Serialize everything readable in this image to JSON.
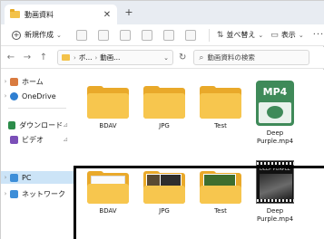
{
  "window": {
    "tab_title": "動画資料",
    "tab_close_icon": "close-icon",
    "new_tab_icon": "plus-icon"
  },
  "toolbar": {
    "new_label": "新規作成",
    "sort_label": "並べ替え",
    "view_label": "表示",
    "more_icon": "more-icon"
  },
  "address": {
    "segments": [
      "ボ...",
      "動画..."
    ],
    "search_placeholder": "動画資料の検索"
  },
  "navpane": {
    "items": [
      {
        "label": "ホーム",
        "icon": "home-icon"
      },
      {
        "label": "OneDrive",
        "icon": "cloud-icon"
      },
      {
        "label": "ダウンロード",
        "icon": "download-icon"
      },
      {
        "label": "ビデオ",
        "icon": "video-icon"
      },
      {
        "label": "PC",
        "icon": "pc-icon"
      },
      {
        "label": "ネットワーク",
        "icon": "network-icon"
      }
    ]
  },
  "content": {
    "top_row": [
      {
        "name": "BDAV",
        "kind": "folder"
      },
      {
        "name": "JPG",
        "kind": "folder"
      },
      {
        "name": "Test",
        "kind": "folder"
      },
      {
        "name": "Deep\nPurple.mp4",
        "kind": "mp4",
        "badge": "MP4"
      }
    ],
    "bottom_row": [
      {
        "name": "BDAV",
        "kind": "folder-preview"
      },
      {
        "name": "JPG",
        "kind": "folder-preview"
      },
      {
        "name": "Test",
        "kind": "folder-preview"
      },
      {
        "name": "Deep\nPurple.mp4",
        "kind": "video-thumbnail",
        "caption": "DEEP PURPLE"
      }
    ]
  }
}
